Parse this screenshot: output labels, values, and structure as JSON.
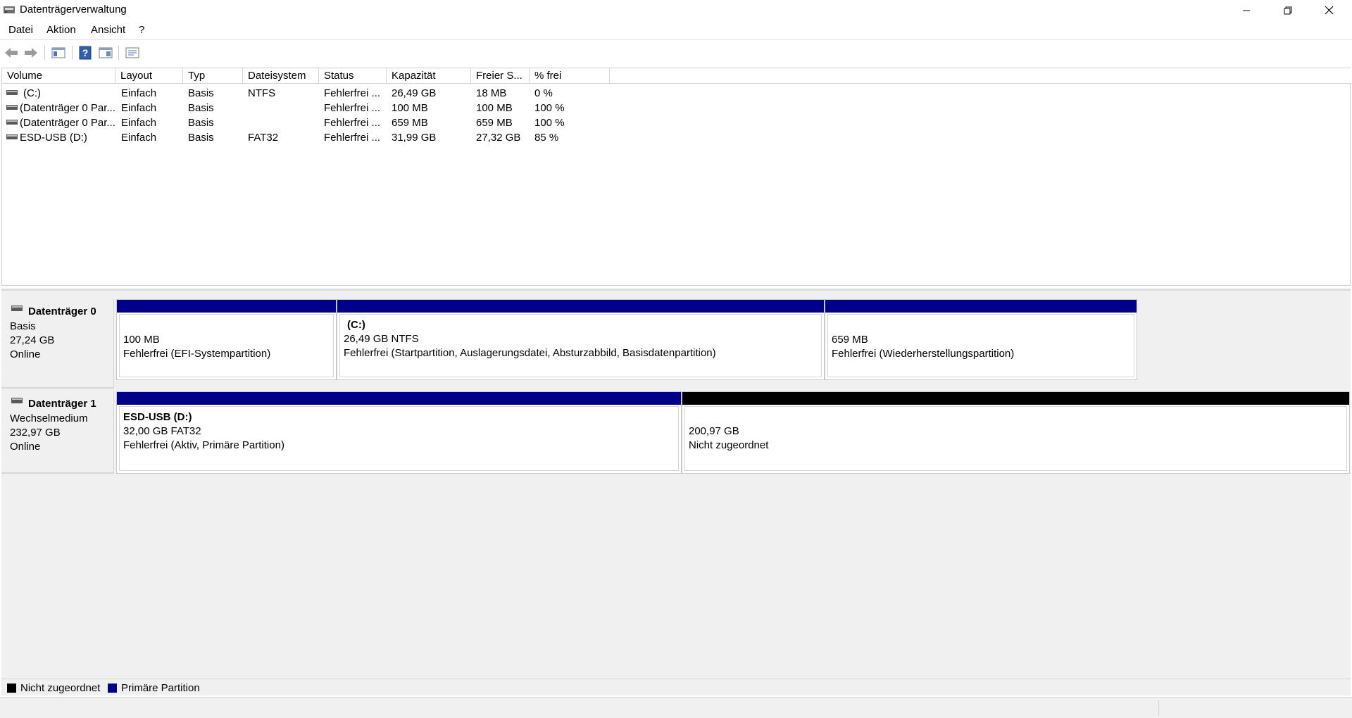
{
  "window": {
    "title": "Datenträgerverwaltung",
    "controls": [
      "minimize-icon",
      "restore-icon",
      "close-icon"
    ]
  },
  "menu": [
    "Datei",
    "Aktion",
    "Ansicht",
    "?"
  ],
  "toolbar": [
    "back-arrow-icon",
    "forward-arrow-icon",
    "console-tree-icon",
    "help-icon",
    "properties-pane-icon",
    "settings-list-icon"
  ],
  "volume_list": {
    "columns": [
      "Volume",
      "Layout",
      "Typ",
      "Dateisystem",
      "Status",
      "Kapazität",
      "Freier S...",
      "% frei"
    ],
    "rows": [
      {
        "volume": "(C:)",
        "layout": "Einfach",
        "typ": "Basis",
        "fs": "NTFS",
        "status": "Fehlerfrei ...",
        "cap": "26,49 GB",
        "free": "18 MB",
        "pct": "0 %"
      },
      {
        "volume": "(Datenträger 0 Par...",
        "layout": "Einfach",
        "typ": "Basis",
        "fs": "",
        "status": "Fehlerfrei ...",
        "cap": "100 MB",
        "free": "100 MB",
        "pct": "100 %"
      },
      {
        "volume": "(Datenträger 0 Par...",
        "layout": "Einfach",
        "typ": "Basis",
        "fs": "",
        "status": "Fehlerfrei ...",
        "cap": "659 MB",
        "free": "659 MB",
        "pct": "100 %"
      },
      {
        "volume": "ESD-USB (D:)",
        "layout": "Einfach",
        "typ": "Basis",
        "fs": "FAT32",
        "status": "Fehlerfrei ...",
        "cap": "31,99 GB",
        "free": "27,32 GB",
        "pct": "85 %"
      }
    ]
  },
  "disks": [
    {
      "name": "Datenträger 0",
      "type": "Basis",
      "size": "27,24 GB",
      "state": "Online",
      "partitions": [
        {
          "title": "",
          "size": "100 MB",
          "status": "Fehlerfrei (EFI-Systempartition)",
          "kind": "primary"
        },
        {
          "title": "(C:)",
          "size": "26,49 GB NTFS",
          "status": "Fehlerfrei (Startpartition, Auslagerungsdatei, Absturzabbild, Basisdatenpartition)",
          "kind": "primary"
        },
        {
          "title": "",
          "size": "659 MB",
          "status": "Fehlerfrei (Wiederherstellungspartition)",
          "kind": "primary"
        }
      ]
    },
    {
      "name": "Datenträger 1",
      "type": "Wechselmedium",
      "size": "232,97 GB",
      "state": "Online",
      "partitions": [
        {
          "title": "ESD-USB  (D:)",
          "size": "32,00 GB FAT32",
          "status": "Fehlerfrei (Aktiv, Primäre Partition)",
          "kind": "primary"
        },
        {
          "title": "",
          "size": "200,97 GB",
          "status": "Nicht zugeordnet",
          "kind": "unallocated"
        }
      ]
    }
  ],
  "legend": [
    {
      "label": "Nicht zugeordnet",
      "color": "#000000"
    },
    {
      "label": "Primäre Partition",
      "color": "#00008b"
    }
  ],
  "colors": {
    "primary": "#00008b",
    "unallocated": "#000000"
  }
}
